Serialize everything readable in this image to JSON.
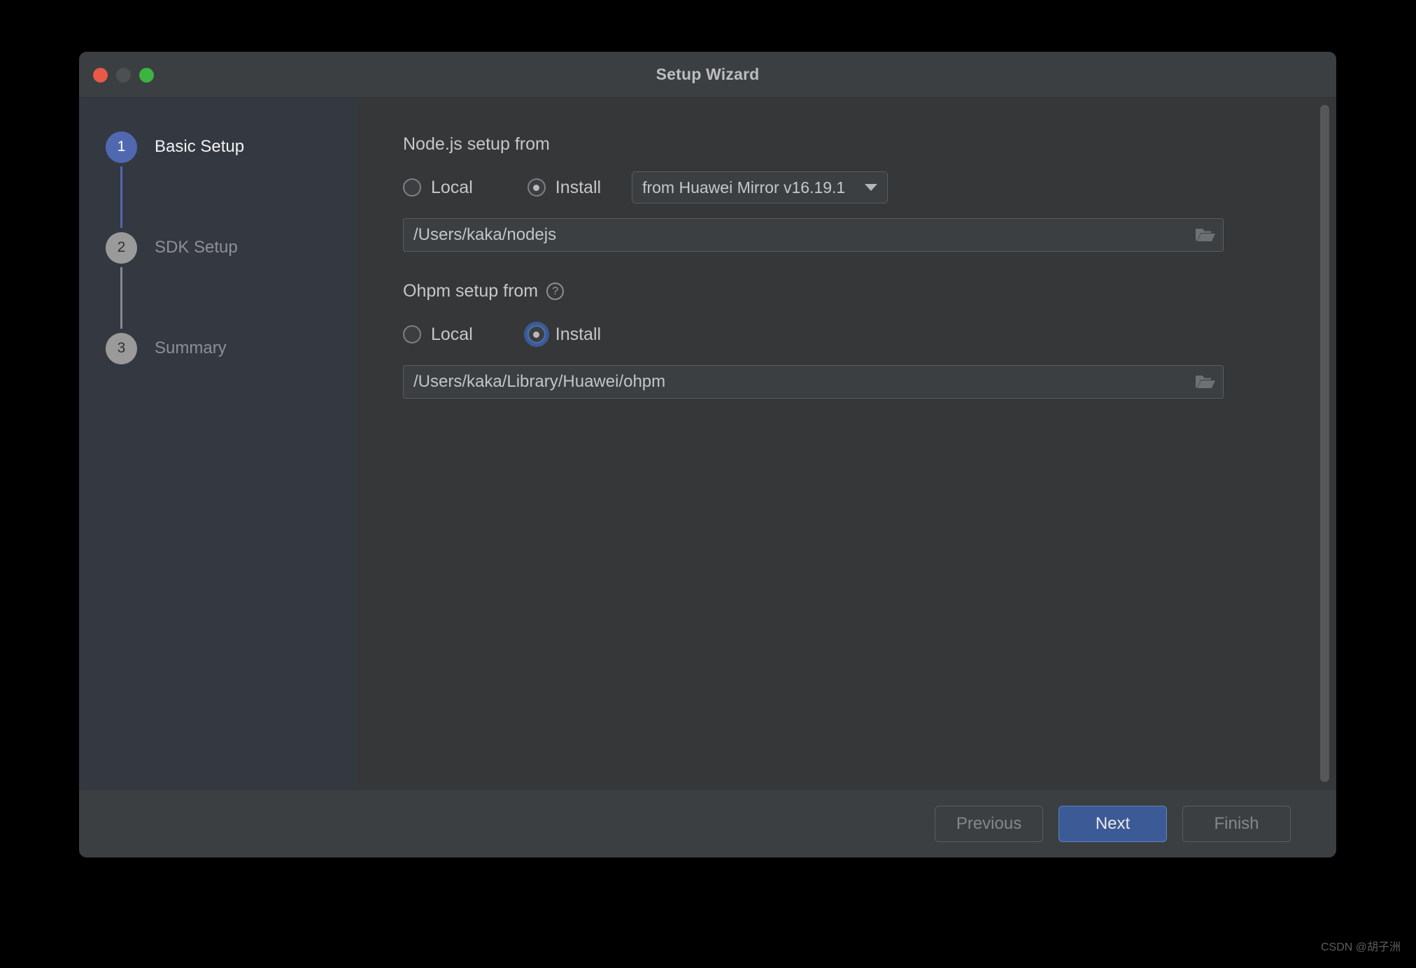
{
  "window": {
    "title": "Setup Wizard",
    "traffic_lights": [
      {
        "name": "close-button",
        "color": "#e8594a"
      },
      {
        "name": "minimize-button",
        "color": "#4e4f51"
      },
      {
        "name": "zoom-button",
        "color": "#3cb440"
      }
    ]
  },
  "sidebar": {
    "steps": [
      {
        "number": "1",
        "label": "Basic Setup",
        "state": "active"
      },
      {
        "number": "2",
        "label": "SDK Setup",
        "state": "inactive"
      },
      {
        "number": "3",
        "label": "Summary",
        "state": "inactive"
      }
    ]
  },
  "content": {
    "nodejs": {
      "section_label": "Node.js setup from",
      "local_label": "Local",
      "install_label": "Install",
      "selected": "Install",
      "mirror_value": "from Huawei Mirror v16.19.1",
      "path_value": "/Users/kaka/nodejs",
      "browse_icon": "folder-icon"
    },
    "ohpm": {
      "section_label": "Ohpm setup from",
      "help_icon": "help-circle-icon",
      "help_glyph": "?",
      "local_label": "Local",
      "install_label": "Install",
      "selected": "Install",
      "path_value": "/Users/kaka/Library/Huawei/ohpm",
      "browse_icon": "folder-icon"
    }
  },
  "footer": {
    "previous_label": "Previous",
    "next_label": "Next",
    "finish_label": "Finish",
    "previous_enabled": false,
    "next_enabled": true,
    "finish_enabled": false
  },
  "watermark": "CSDN @胡子洲",
  "colors": {
    "accent_blue": "#5068b0",
    "primary_button": "#3c5b96",
    "sidebar_bg": "#343841",
    "content_bg": "#363739",
    "chrome_bg": "#3c3f41"
  }
}
